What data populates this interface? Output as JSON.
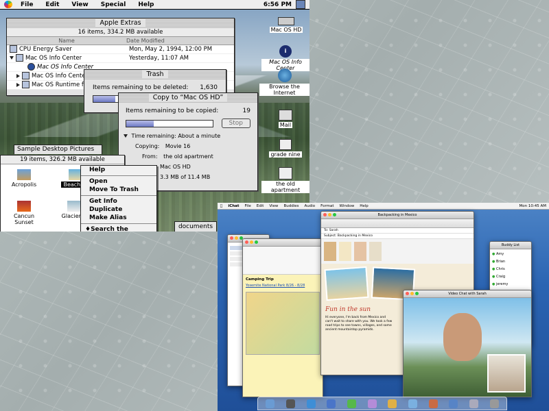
{
  "os9": {
    "menubar": {
      "items": [
        "File",
        "Edit",
        "View",
        "Special",
        "Help"
      ],
      "clock": "6:56 PM"
    },
    "apple_extras": {
      "title": "Apple Extras",
      "summary": "16 items, 334.2 MB available",
      "col_name": "Name",
      "col_date": "Date Modified",
      "rows": [
        {
          "name": "CPU Energy Saver",
          "date": "Mon, May 2, 1994, 12:00 PM"
        },
        {
          "name": "Mac OS Info Center",
          "date": "Yesterday, 11:07 AM"
        },
        {
          "name": "Mac OS Info Center",
          "date": ""
        },
        {
          "name": "Mac OS Info Center",
          "date": ""
        },
        {
          "name": "Mac OS Runtime for J",
          "date": ""
        }
      ]
    },
    "trash": {
      "title": "Trash",
      "label": "Items remaining to be deleted:",
      "count": "1,630",
      "progress": 0.18
    },
    "copy": {
      "title": "Copy to “Mac OS HD”",
      "label": "Items remaining to be copied:",
      "count": "19",
      "progress": 0.32,
      "stop": "Stop",
      "time_label": "Time remaining:",
      "time_value": "About a minute",
      "copying_label": "Copying:",
      "copying_value": "Movie 16",
      "from_label": "From:",
      "from_value": "the old apartment",
      "to_value": "Mac OS HD",
      "size_value": "3.3 MB of 11.4 MB"
    },
    "desktop_pictures": {
      "title": "Sample Desktop Pictures",
      "summary": "19 items, 326.2 MB available",
      "items": [
        "Acropolis",
        "Beach of",
        "Cancun Sunset",
        "Glacier N"
      ]
    },
    "context_menu": {
      "items": [
        "Help",
        "Open",
        "Move To Trash",
        "Get Info",
        "Duplicate",
        "Make Alias",
        "♦Search the Internet"
      ]
    },
    "desktop_icons": [
      "Mac OS HD",
      "Mac OS Info Center",
      "Browse the Internet",
      "Mail",
      "grade nine",
      "the old apartment",
      "documents"
    ]
  },
  "osx": {
    "menubar": {
      "items": [
        "iChat",
        "File",
        "Edit",
        "View",
        "Buddies",
        "Audio",
        "Format",
        "Window",
        "Help"
      ],
      "clock": "Mon 10:45 AM"
    },
    "mail": {
      "subject_label": "Subject:",
      "subject": "Backpacking in Mexico",
      "to_label": "To:",
      "to": "Sarah",
      "headline": "Fun in the sun",
      "body": "Hi everyone, I'm back from Mexico and can't wait to share with you. We took a few road trips to see towns, villages, and some ancient mountaintop pyramids."
    },
    "notes": {
      "title": "Camping Trip",
      "link": "Yosemite National Park 8/26 - 8/28"
    },
    "video_chat": {
      "title": "Video Chat with Sarah"
    },
    "buddy_list": {
      "title": "Buddy List",
      "buddies": [
        "Amy",
        "Brian",
        "Chris",
        "Craig",
        "jeremy"
      ]
    },
    "colors": {
      "desktop": "#2b64b2",
      "aqua_close": "#ff5f57",
      "aqua_min": "#febc2e",
      "aqua_zoom": "#28c840"
    }
  }
}
